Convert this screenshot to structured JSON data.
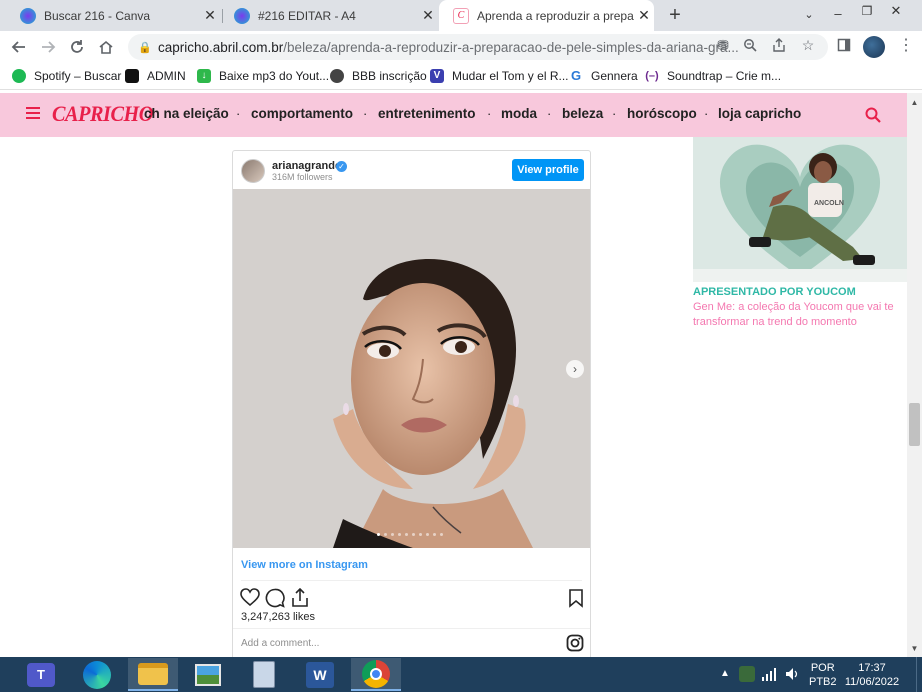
{
  "browser": {
    "tabs": [
      {
        "label": "Buscar 216 - Canva",
        "active": false
      },
      {
        "label": "#216 EDITAR - A4",
        "active": false
      },
      {
        "label": "Aprenda a reproduzir a preparaç",
        "active": true
      }
    ],
    "new_tab_symbol": "+",
    "address": {
      "host": "capricho.abril.com.br",
      "path": "/beleza/aprenda-a-reproduzir-a-preparacao-de-pele-simples-da-ariana-gra..."
    },
    "bookmarks": [
      {
        "label": "Spotify – Buscar",
        "icon": "spotify-icon",
        "color": "#1db954"
      },
      {
        "label": "ADMIN",
        "icon": "admin-icon",
        "color": "#111111"
      },
      {
        "label": "Baixe mp3 do Yout...",
        "icon": "download-icon",
        "color": "#2eb84b"
      },
      {
        "label": "BBB inscrição",
        "icon": "globe-icon",
        "color": "#444444"
      },
      {
        "label": "Mudar el Tom y el R...",
        "icon": "v-icon",
        "color": "#3b3fb0"
      },
      {
        "label": "Gennera",
        "icon": "gennera-icon",
        "color": "#2b79d6"
      },
      {
        "label": "Soundtrap – Crie m...",
        "icon": "soundtrap-icon",
        "color": "#6d2a8f"
      }
    ]
  },
  "site": {
    "logo": "CAPRICHO",
    "nav": [
      "ch na eleição",
      "comportamento",
      "entretenimento",
      "moda",
      "beleza",
      "horóscopo",
      "loja capricho"
    ],
    "accent": "#f8c8dc",
    "logo_color": "#e8204a"
  },
  "instagram": {
    "username": "arianagrande",
    "followers": "316M followers",
    "view_profile": "View profile",
    "view_more": "View more on Instagram",
    "likes": "3,247,263 likes",
    "comment_placeholder": "Add a comment...",
    "carousel_slides": 10,
    "carousel_current": 1
  },
  "ad": {
    "sponsor": "APRESENTADO POR YOUCOM",
    "title": "Gen Me: a coleção da Youcom que vai te transformar na trend do momento",
    "shirt_text": "ANCOLN"
  },
  "taskbar": {
    "apps": [
      "teams-icon",
      "edge-icon",
      "file-explorer-icon",
      "photos-icon",
      "calculator-icon",
      "word-icon",
      "chrome-icon"
    ],
    "language": "POR",
    "layout": "PTB2",
    "time": "17:37",
    "date": "11/06/2022"
  }
}
